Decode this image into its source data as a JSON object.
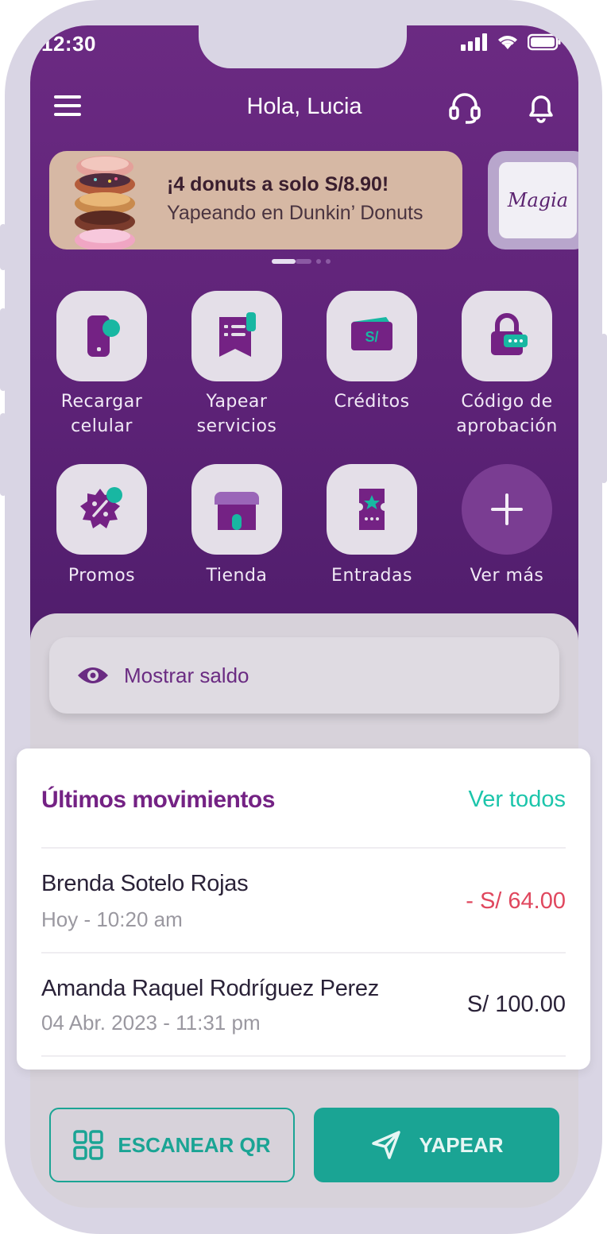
{
  "status_bar": {
    "time": "12:30"
  },
  "header": {
    "greeting": "Hola, Lucia",
    "menu_icon": "hamburger-icon",
    "support_icon": "headset-icon",
    "notifications_icon": "bell-icon"
  },
  "banner": {
    "title": "¡4 donuts a solo S/8.90!",
    "subtitle": "Yapeando en Dunkin’ Donuts",
    "next_banner_text": "Magia"
  },
  "shortcuts": [
    {
      "label_line1": "Recargar",
      "label_line2": "celular",
      "icon": "phone-icon"
    },
    {
      "label_line1": "Yapear",
      "label_line2": "servicios",
      "icon": "receipt-icon"
    },
    {
      "label_line1": "Créditos",
      "label_line2": "",
      "icon": "money-icon",
      "icon_text": "S/"
    },
    {
      "label_line1": "Código de",
      "label_line2": "aprobación",
      "icon": "lock-icon"
    },
    {
      "label_line1": "Promos",
      "label_line2": "",
      "icon": "discount-badge-icon"
    },
    {
      "label_line1": "Tienda",
      "label_line2": "",
      "icon": "store-icon"
    },
    {
      "label_line1": "Entradas",
      "label_line2": "",
      "icon": "ticket-icon"
    },
    {
      "label_line1": "Ver más",
      "label_line2": "",
      "icon": "plus-icon"
    }
  ],
  "balance": {
    "label": "Mostrar saldo",
    "icon": "eye-icon"
  },
  "movements": {
    "title": "Últimos movimientos",
    "view_all": "Ver todos",
    "items": [
      {
        "name": "Brenda Sotelo Rojas",
        "date": "Hoy - 10:20 am",
        "amount": "- S/ 64.00",
        "type": "debit"
      },
      {
        "name": "Amanda Raquel Rodríguez Perez",
        "date": "04 Abr. 2023 - 11:31 pm",
        "amount": "S/ 100.00",
        "type": "credit"
      }
    ]
  },
  "actions": {
    "scan": "ESCANEAR QR",
    "pay": "YAPEAR"
  },
  "colors": {
    "brand_purple": "#742284",
    "teal": "#1aa494",
    "debit_red": "#e0475e"
  }
}
